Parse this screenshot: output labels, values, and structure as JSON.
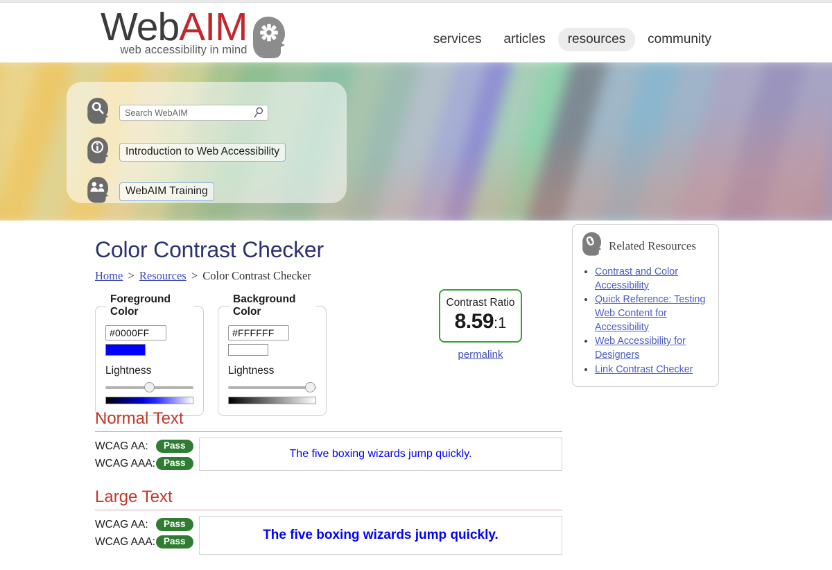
{
  "header": {
    "logo": {
      "text_primary": "Web",
      "text_accent": "AIM",
      "tagline": "web accessibility in mind",
      "icon": "head-gear-icon"
    },
    "nav": [
      {
        "label": "services",
        "active": false
      },
      {
        "label": "articles",
        "active": false
      },
      {
        "label": "resources",
        "active": true
      },
      {
        "label": "community",
        "active": false
      }
    ]
  },
  "hero": {
    "search": {
      "placeholder": "Search WebAIM",
      "value": "",
      "icon": "head-magnifier-icon",
      "submit_icon": "search-icon"
    },
    "links": [
      {
        "label": "Introduction to Web Accessibility",
        "icon": "head-info-icon"
      },
      {
        "label": "WebAIM Training",
        "icon": "head-people-icon"
      }
    ]
  },
  "main": {
    "title": "Color Contrast Checker",
    "breadcrumb": {
      "home": "Home",
      "resources": "Resources",
      "current": "Color Contrast Checker",
      "separator": ">"
    },
    "foreground": {
      "legend": "Foreground Color",
      "hex": "#0000FF",
      "swatch_color": "#0000FF",
      "lightness_label": "Lightness",
      "lightness_value": 50,
      "gradient": "black-blue-white"
    },
    "background": {
      "legend": "Background Color",
      "hex": "#FFFFFF",
      "swatch_color": "#FFFFFF",
      "lightness_label": "Lightness",
      "lightness_value": 95,
      "gradient": "black-white"
    },
    "contrast": {
      "label": "Contrast Ratio",
      "value": "8.59",
      "suffix": ":1",
      "border_color": "#36a036",
      "permalink_label": "permalink"
    },
    "results": [
      {
        "heading": "Normal Text",
        "checks": [
          {
            "label": "WCAG AA:",
            "status": "Pass"
          },
          {
            "label": "WCAG AAA:",
            "status": "Pass"
          }
        ],
        "sample_text": "The five boxing wizards jump quickly.",
        "sample_size": "normal"
      },
      {
        "heading": "Large Text",
        "checks": [
          {
            "label": "WCAG AA:",
            "status": "Pass"
          },
          {
            "label": "WCAG AAA:",
            "status": "Pass"
          }
        ],
        "sample_text": "The five boxing wizards jump quickly.",
        "sample_size": "large"
      }
    ]
  },
  "related": {
    "title": "Related Resources",
    "icon": "head-link-icon",
    "links": [
      "Contrast and Color Accessibility",
      "Quick Reference: Testing Web Content for Accessibility",
      "Web Accessibility for Designers",
      "Link Contrast Checker"
    ]
  },
  "colors": {
    "brand_red": "#c1272d",
    "title_navy": "#2c3270",
    "pass_green": "#2f7d32",
    "heading_red": "#c0392b",
    "link_blue": "#3b4cb8",
    "sample_fg": "#0000FF",
    "sample_bg": "#FFFFFF"
  }
}
